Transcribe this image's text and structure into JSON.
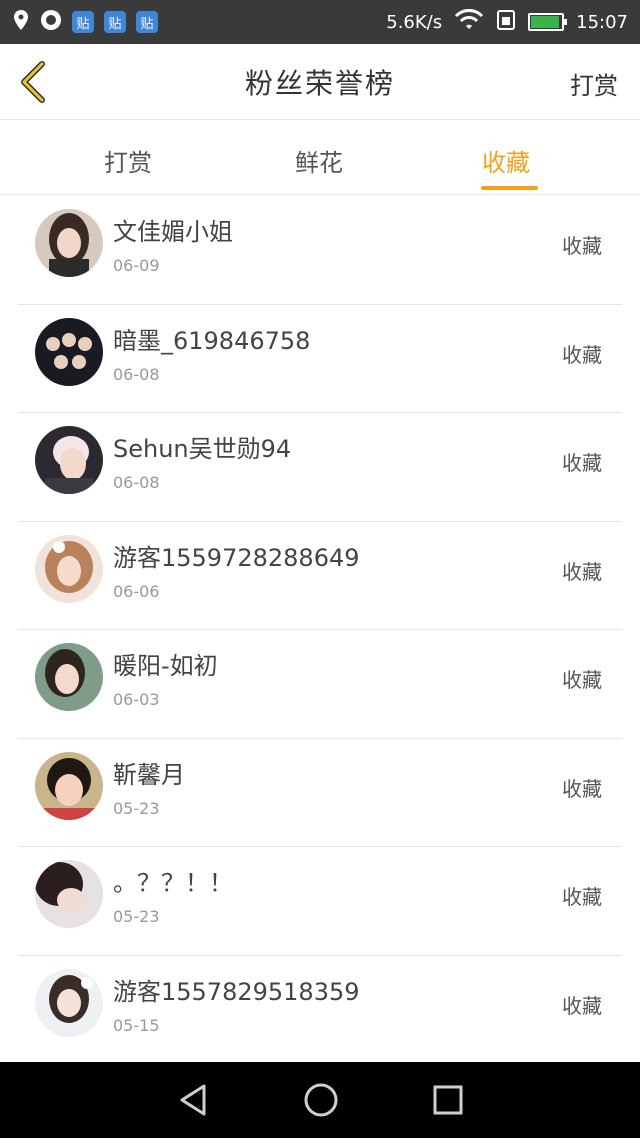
{
  "status_bar": {
    "badges": [
      "贴",
      "贴",
      "贴"
    ],
    "net_speed": "5.6K/s",
    "time": "15:07"
  },
  "header": {
    "title": "粉丝荣誉榜",
    "right_action": "打赏"
  },
  "tabs": [
    {
      "label": "打赏",
      "active": false
    },
    {
      "label": "鲜花",
      "active": false
    },
    {
      "label": "收藏",
      "active": true
    }
  ],
  "list": [
    {
      "name": "文佳媚小姐",
      "date": "06-09",
      "action": "收藏"
    },
    {
      "name": "暗墨_619846758",
      "date": "06-08",
      "action": "收藏"
    },
    {
      "name": "Sehun吴世勋94",
      "date": "06-08",
      "action": "收藏"
    },
    {
      "name": "游客1559728288649",
      "date": "06-06",
      "action": "收藏"
    },
    {
      "name": "暖阳-如初",
      "date": "06-03",
      "action": "收藏"
    },
    {
      "name": "靳馨月",
      "date": "05-23",
      "action": "收藏"
    },
    {
      "name": "。？？！！",
      "date": "05-23",
      "action": "收藏"
    },
    {
      "name": "游客1557829518359",
      "date": "05-15",
      "action": "收藏"
    }
  ],
  "colors": {
    "accent": "#f4a21a",
    "status_bar_bg": "#3a3a3a",
    "nav_bar_bg": "#000000"
  }
}
